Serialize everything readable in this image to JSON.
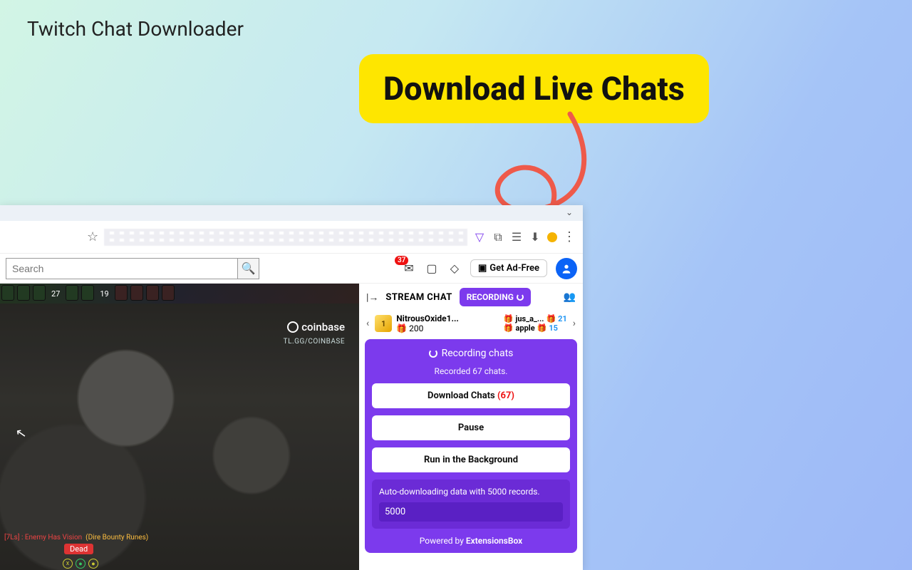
{
  "page_title": "Twitch Chat Downloader",
  "callout": "Download Live Chats",
  "browser": {
    "search_placeholder": "Search",
    "badge_count": "37",
    "get_ad_label": "Get Ad-Free"
  },
  "video": {
    "sponsor": "coinbase",
    "sponsor_sub": "TL.GG/COINBASE",
    "score_left": "27",
    "score_right": "19",
    "vision_line": "[7Ls] : Enemy Has Vision",
    "rune_line": "(Dire Bounty Runes)",
    "dead_label": "Dead"
  },
  "chat": {
    "stream_chat_label": "STREAM CHAT",
    "recording_label": "RECORDING",
    "gifts": [
      {
        "name": "NitrousOxide1...",
        "count": "200"
      },
      {
        "name": "jus_a_...",
        "count": "21",
        "name2": "apple",
        "count2": "15"
      }
    ]
  },
  "popup": {
    "status": "Recording chats",
    "substatus": "Recorded 67 chats.",
    "download_label": "Download Chats",
    "download_count": "(67)",
    "pause_label": "Pause",
    "background_label": "Run in the Background",
    "auto_label": "Auto-downloading data with 5000 records.",
    "auto_value": "5000",
    "powered_prefix": "Powered by ",
    "powered_link": "ExtensionsBox"
  }
}
